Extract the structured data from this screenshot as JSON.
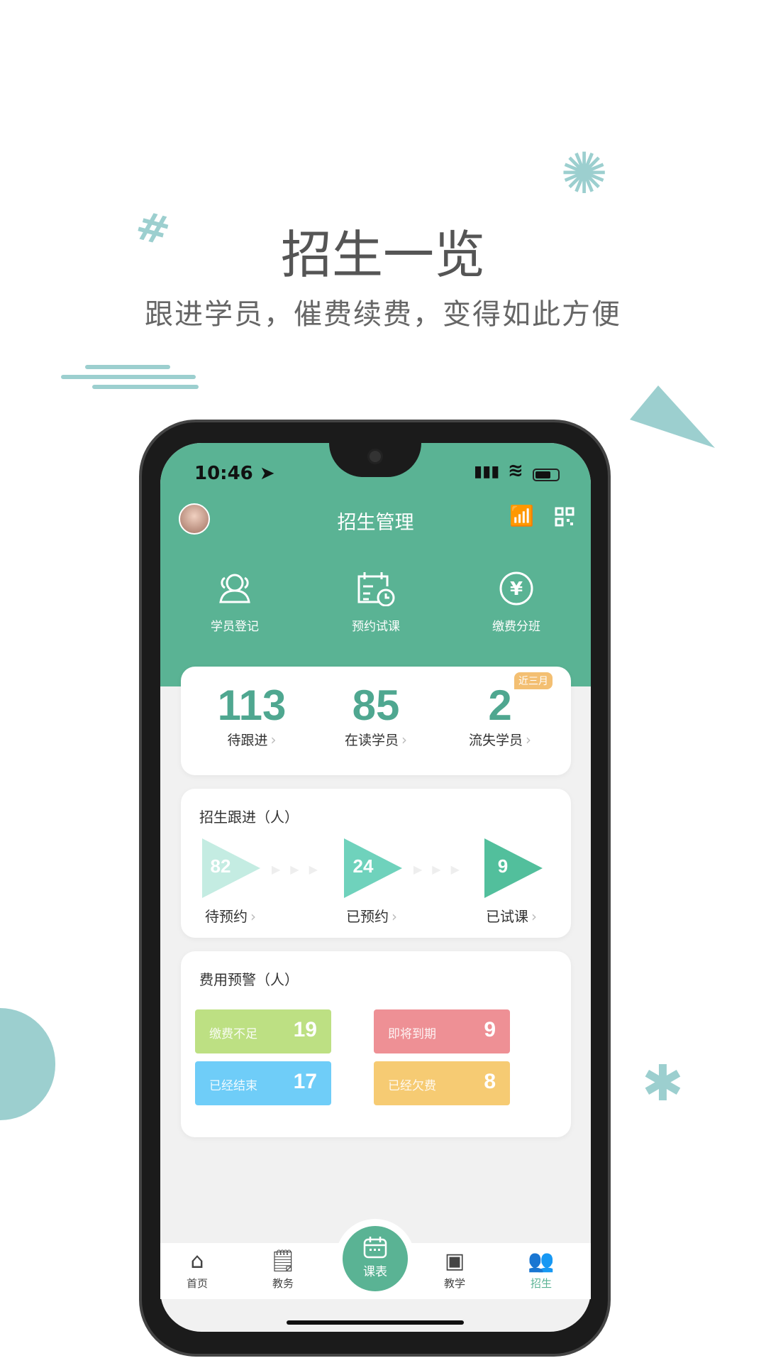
{
  "promo": {
    "title": "招生一览",
    "subtitle": "跟进学员，催费续费，变得如此方便"
  },
  "colors": {
    "primary": "#5ab394",
    "decor": "#9ccfcf",
    "badge": "#f2b45a"
  },
  "status_bar": {
    "time": "10:46"
  },
  "header": {
    "title": "招生管理",
    "right_icons": [
      "chart-icon",
      "qr-code-icon"
    ]
  },
  "quick_actions": [
    {
      "label": "学员登记",
      "icon": "users-icon"
    },
    {
      "label": "预约试课",
      "icon": "calendar-clock-icon"
    },
    {
      "label": "缴费分班",
      "icon": "yen-icon"
    }
  ],
  "stats": [
    {
      "value": "113",
      "label": "待跟进"
    },
    {
      "value": "85",
      "label": "在读学员"
    },
    {
      "value": "2",
      "label": "流失学员",
      "badge": "近三月"
    }
  ],
  "followup": {
    "title": "招生跟进（人）",
    "steps": [
      {
        "value": "82",
        "label": "待预约",
        "color": "#c4ece2"
      },
      {
        "value": "24",
        "label": "已预约",
        "color": "#6fd2bc"
      },
      {
        "value": "9",
        "label": "已试课",
        "color": "#52bf9c"
      }
    ]
  },
  "fee_warning": {
    "title": "费用预警（人）",
    "items": [
      {
        "label": "缴费不足",
        "value": "19",
        "color": "#bde083"
      },
      {
        "label": "即将到期",
        "value": "9",
        "color": "#ee9095"
      },
      {
        "label": "已经结束",
        "value": "17",
        "color": "#6fcdf8"
      },
      {
        "label": "已经欠费",
        "value": "8",
        "color": "#f6cb73"
      }
    ]
  },
  "tabs": [
    {
      "label": "首页",
      "icon": "home-icon"
    },
    {
      "label": "教务",
      "icon": "document-icon"
    },
    {
      "label": "课表",
      "icon": "calendar-icon"
    },
    {
      "label": "教学",
      "icon": "teaching-icon"
    },
    {
      "label": "招生",
      "icon": "users-icon",
      "active": true
    }
  ]
}
